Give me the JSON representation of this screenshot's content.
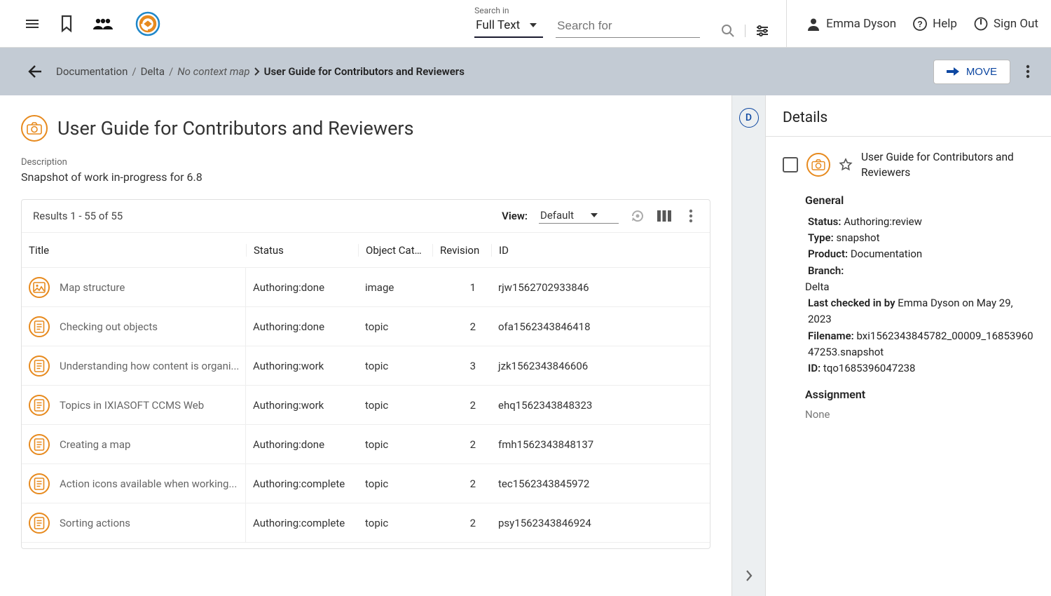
{
  "header": {
    "search_in_label": "Search in",
    "search_in_value": "Full Text",
    "search_placeholder": "Search for",
    "user_name": "Emma Dyson",
    "help_label": "Help",
    "signout_label": "Sign Out"
  },
  "breadcrumb": {
    "p0": "Documentation",
    "p1": "Delta",
    "p2": "No context map",
    "current": "User Guide for Contributors and Reviewers",
    "move_label": "MOVE"
  },
  "page": {
    "title": "User Guide for Contributors and Reviewers",
    "desc_label": "Description",
    "desc_text": "Snapshot of work in-progress for 6.8",
    "results_text": "Results 1 - 55 of 55",
    "view_label": "View:",
    "view_value": "Default"
  },
  "columns": {
    "c0": "Title",
    "c1": "Status",
    "c2": "Object Cat…",
    "c3": "Revision",
    "c4": "ID"
  },
  "rows": [
    {
      "icon": "image",
      "title": "Map structure",
      "status": "Authoring:done",
      "cat": "image",
      "rev": "1",
      "id": "rjw1562702933846"
    },
    {
      "icon": "topic",
      "title": "Checking out objects",
      "status": "Authoring:done",
      "cat": "topic",
      "rev": "2",
      "id": "ofa1562343846418"
    },
    {
      "icon": "topic",
      "title": "Understanding how content is organi...",
      "status": "Authoring:work",
      "cat": "topic",
      "rev": "3",
      "id": "jzk1562343846606"
    },
    {
      "icon": "topic",
      "title": "Topics in IXIASOFT CCMS Web",
      "status": "Authoring:work",
      "cat": "topic",
      "rev": "2",
      "id": "ehq1562343848323"
    },
    {
      "icon": "topic",
      "title": "Creating a map",
      "status": "Authoring:done",
      "cat": "topic",
      "rev": "2",
      "id": "fmh1562343848137"
    },
    {
      "icon": "topic",
      "title": "Action icons available when working...",
      "status": "Authoring:complete",
      "cat": "topic",
      "rev": "2",
      "id": "tec1562343845972"
    },
    {
      "icon": "topic",
      "title": "Sorting actions",
      "status": "Authoring:complete",
      "cat": "topic",
      "rev": "2",
      "id": "psy1562343846924"
    }
  ],
  "details": {
    "panel_title": "Details",
    "item_title": "User Guide for Contributors and Reviewers",
    "general_h": "General",
    "status_l": "Status:",
    "status_v": "Authoring:review",
    "type_l": "Type:",
    "type_v": "snapshot",
    "product_l": "Product:",
    "product_v": "Documentation",
    "branch_l": "Branch:",
    "branch_v": "Delta",
    "lastcheck_l": "Last checked in by",
    "lastcheck_v": "Emma Dyson on May 29, 2023",
    "filename_l": "Filename:",
    "filename_v": "bxi1562343845782_00009_1685396047253.snapshot",
    "id_l": "ID:",
    "id_v": "tqo1685396047238",
    "assignment_h": "Assignment",
    "assignment_none": "None"
  }
}
